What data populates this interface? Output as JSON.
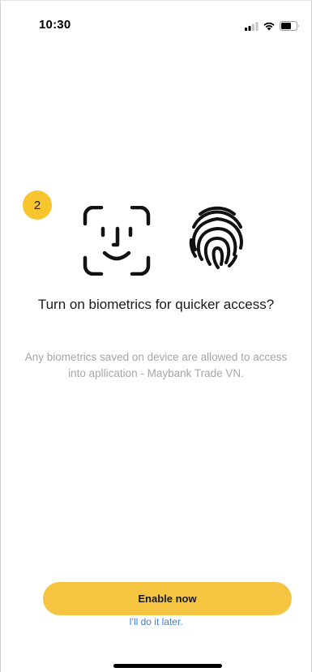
{
  "status_bar": {
    "time": "10:30",
    "icons": [
      "cellular-signal-icon",
      "wifi-icon",
      "battery-icon"
    ]
  },
  "step_badge": {
    "number": "2"
  },
  "content": {
    "icons": [
      "face-id-icon",
      "fingerprint-icon"
    ],
    "title": "Turn on biometrics for quicker access?",
    "description": "Any biometrics saved on device are allowed to access into apllication - Maybank Trade VN."
  },
  "actions": {
    "enable_label": "Enable now",
    "later_label": "I'll do it later."
  },
  "colors": {
    "accent": "#f5c542",
    "badge": "#f7c52e",
    "link": "#3f7fd1",
    "description_text": "#a6a6a6"
  }
}
